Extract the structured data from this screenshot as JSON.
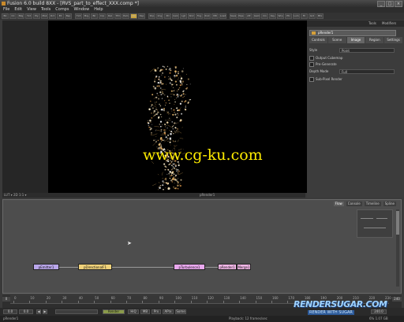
{
  "window": {
    "title": "Fusion 6.0 build 8XX - [RVS_part_to_effect_XXX.comp *]",
    "controls": [
      "_",
      "□",
      "×"
    ]
  },
  "menu": [
    "File",
    "Edit",
    "View",
    "Tools",
    "Comps",
    "Window",
    "Help"
  ],
  "toolbar": {
    "buttons": [
      "BC",
      "CC",
      "Bkg",
      "Txt",
      "Ply",
      "Msk",
      "Rct",
      "Ell",
      "Bsp",
      "Tx3",
      "Mrg",
      "Blr",
      "Crp",
      "Rsz",
      "Tfm",
      "Pem",
      "pRn",
      "Dsp",
      "Shp",
      "Img",
      "3D",
      "Cam",
      "Lgt",
      "Shd",
      "Fog",
      "Rnd",
      "Mtl",
      "Loader",
      "Saver",
      "Pipe",
      "ATr",
      "Gam",
      "Cin",
      "Key",
      "Wrp",
      "Ptc",
      "Lum",
      "Fil",
      "Grd",
      "Mtx"
    ]
  },
  "viewer": {
    "watermark": "www.cg-ku.com",
    "bar_left": "LUT ▾  2D  1:1  ▾",
    "bar_right": "pRender1"
  },
  "inspector": {
    "top_tabs": [
      "Tools",
      "Modifiers"
    ],
    "tool_name": "pRender1",
    "tabs": [
      "Controls",
      "Scene",
      "Image",
      "Region",
      "Settings"
    ],
    "active_tab": "Image",
    "rows": [
      {
        "label": "Style",
        "value": "Point"
      },
      {
        "label": "Output Cubemap",
        "value": ""
      },
      {
        "label": "Pre-Generate",
        "value": ""
      },
      {
        "label": "Depth Mode",
        "value": "Full"
      },
      {
        "label": "Sub-Pixel Render",
        "value": ""
      }
    ]
  },
  "flow": {
    "tabs": [
      "Flow",
      "Console",
      "Timeline",
      "Spline"
    ],
    "active_tab": "Flow",
    "nodes": [
      {
        "label": "pEmitter1",
        "color": "#b9a6ea"
      },
      {
        "label": "pDirectionalF1",
        "color": "#f0d27a"
      },
      {
        "label": "pTurbulence1",
        "color": "#e9a8ee"
      },
      {
        "label": "pRender1",
        "color": "#f0b6e6"
      },
      {
        "label": "Merge1",
        "color": "#f0b6e6"
      }
    ]
  },
  "timeline": {
    "ticks": [
      "0",
      "10",
      "20",
      "30",
      "40",
      "50",
      "60",
      "70",
      "80",
      "90",
      "100",
      "110",
      "120",
      "130",
      "140",
      "150",
      "160",
      "170",
      "180",
      "190",
      "200",
      "210",
      "220",
      "230"
    ],
    "start": "0",
    "end": "240"
  },
  "transport": {
    "current": "0.0",
    "range_start": "0.0",
    "range_end": "240.0",
    "render_label": "Render",
    "hq": "HiQ",
    "mb": "MB",
    "prx": "Prx",
    "aprx": "APrx",
    "some": "Some"
  },
  "status": {
    "left": "pRender1",
    "middle": "Playback: 12 frames/sec",
    "right": "6% 1.07 GB"
  },
  "logo": {
    "line1": "RENDERSUGAR.COM",
    "line2": "RENDER WITH SUGAR"
  },
  "colors": {
    "accent": "#c8a23a",
    "viewer_bg": "#000000",
    "panel_bg": "#3a3a3a",
    "flow_bg": "#4d4d4d",
    "watermark": "#ffec00"
  }
}
